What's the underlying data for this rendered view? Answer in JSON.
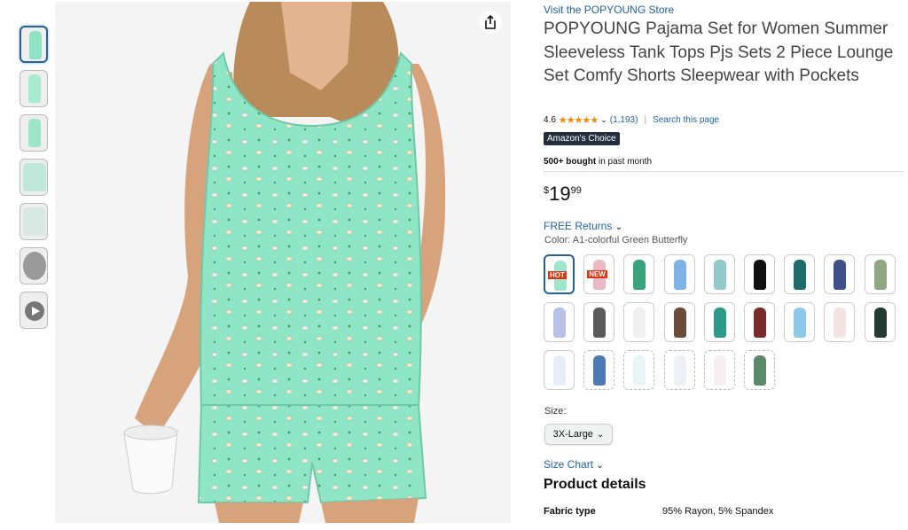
{
  "thumbnails": [
    {
      "label": "",
      "type": "image"
    },
    {
      "label": "",
      "type": "image"
    },
    {
      "label": "",
      "type": "image"
    },
    {
      "label": "",
      "type": "image"
    },
    {
      "label": "",
      "type": "image"
    },
    {
      "label": "",
      "type": "image"
    },
    {
      "label": "",
      "type": "video"
    }
  ],
  "product": {
    "store_link": "Visit the POPYOUNG Store",
    "title": "POPYOUNG Pajama Set for Women Summer Sleeveless Tank Tops Pjs Sets 2 Piece Lounge Set Comfy Shorts Sleepwear with Pockets",
    "rating": "4.6",
    "stars": "★★★★★",
    "review_count": "(1,193)",
    "search_page": "Search this page",
    "badge": "Amazon's Choice",
    "bought_bold": "500+ bought",
    "bought_rest": " in past month",
    "price_symbol": "$",
    "price_whole": "19",
    "price_fraction": "99",
    "returns": "FREE Returns",
    "color_label": "Color: A1-colorful Green Butterfly",
    "size_label": "Size:",
    "size_value": "3X-Large",
    "size_chart": "Size Chart",
    "details_title": "Product details",
    "details": [
      {
        "key": "Fabric type",
        "value": "95% Rayon, 5% Spandex"
      }
    ]
  },
  "swatches": [
    {
      "color": "#9fe6cf",
      "tag": "HOT"
    },
    {
      "color": "#e9b9c4",
      "tag": "NEW"
    },
    {
      "color": "#3aa37e",
      "tag": ""
    },
    {
      "color": "#7fb3e6",
      "tag": ""
    },
    {
      "color": "#93c9c9",
      "tag": ""
    },
    {
      "color": "#111111",
      "tag": ""
    },
    {
      "color": "#1d6b6b",
      "tag": ""
    },
    {
      "color": "#3f4f8a",
      "tag": ""
    },
    {
      "color": "#8fa882",
      "tag": ""
    },
    {
      "color": "#b9c2e6",
      "tag": ""
    },
    {
      "color": "#5b5b5b",
      "tag": ""
    },
    {
      "color": "#f0f0f0",
      "tag": ""
    },
    {
      "color": "#6b4b3b",
      "tag": ""
    },
    {
      "color": "#2c9a88",
      "tag": ""
    },
    {
      "color": "#7a2c2c",
      "tag": ""
    },
    {
      "color": "#8cc8e8",
      "tag": ""
    },
    {
      "color": "#f3e4e2",
      "tag": ""
    },
    {
      "color": "#233b33",
      "tag": ""
    },
    {
      "color": "#e8eef8",
      "tag": ""
    },
    {
      "color": "#4c7ab8",
      "tag": ""
    },
    {
      "color": "#e8f6f8",
      "tag": ""
    },
    {
      "color": "#eef0f6",
      "tag": ""
    },
    {
      "color": "#f6eef0",
      "tag": ""
    },
    {
      "color": "#5b8a6a",
      "tag": ""
    }
  ],
  "colors": {
    "link": "#2162a1",
    "star": "#f08804",
    "badge": "#232f3e",
    "main_fabric": "#8fe6c6"
  }
}
